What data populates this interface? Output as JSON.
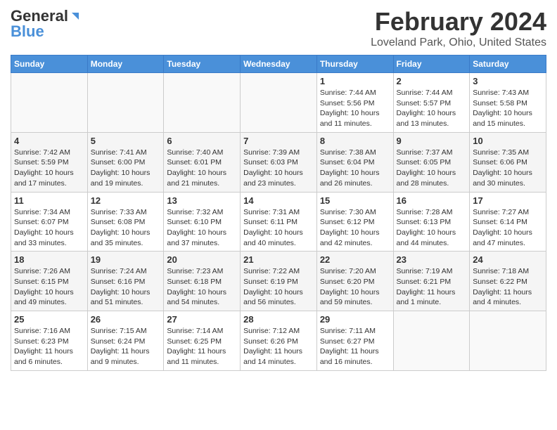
{
  "header": {
    "logo_general": "General",
    "logo_blue": "Blue",
    "month_title": "February 2024",
    "location": "Loveland Park, Ohio, United States"
  },
  "calendar": {
    "days_of_week": [
      "Sunday",
      "Monday",
      "Tuesday",
      "Wednesday",
      "Thursday",
      "Friday",
      "Saturday"
    ],
    "weeks": [
      [
        {
          "day": "",
          "info": ""
        },
        {
          "day": "",
          "info": ""
        },
        {
          "day": "",
          "info": ""
        },
        {
          "day": "",
          "info": ""
        },
        {
          "day": "1",
          "info": "Sunrise: 7:44 AM\nSunset: 5:56 PM\nDaylight: 10 hours\nand 11 minutes."
        },
        {
          "day": "2",
          "info": "Sunrise: 7:44 AM\nSunset: 5:57 PM\nDaylight: 10 hours\nand 13 minutes."
        },
        {
          "day": "3",
          "info": "Sunrise: 7:43 AM\nSunset: 5:58 PM\nDaylight: 10 hours\nand 15 minutes."
        }
      ],
      [
        {
          "day": "4",
          "info": "Sunrise: 7:42 AM\nSunset: 5:59 PM\nDaylight: 10 hours\nand 17 minutes."
        },
        {
          "day": "5",
          "info": "Sunrise: 7:41 AM\nSunset: 6:00 PM\nDaylight: 10 hours\nand 19 minutes."
        },
        {
          "day": "6",
          "info": "Sunrise: 7:40 AM\nSunset: 6:01 PM\nDaylight: 10 hours\nand 21 minutes."
        },
        {
          "day": "7",
          "info": "Sunrise: 7:39 AM\nSunset: 6:03 PM\nDaylight: 10 hours\nand 23 minutes."
        },
        {
          "day": "8",
          "info": "Sunrise: 7:38 AM\nSunset: 6:04 PM\nDaylight: 10 hours\nand 26 minutes."
        },
        {
          "day": "9",
          "info": "Sunrise: 7:37 AM\nSunset: 6:05 PM\nDaylight: 10 hours\nand 28 minutes."
        },
        {
          "day": "10",
          "info": "Sunrise: 7:35 AM\nSunset: 6:06 PM\nDaylight: 10 hours\nand 30 minutes."
        }
      ],
      [
        {
          "day": "11",
          "info": "Sunrise: 7:34 AM\nSunset: 6:07 PM\nDaylight: 10 hours\nand 33 minutes."
        },
        {
          "day": "12",
          "info": "Sunrise: 7:33 AM\nSunset: 6:08 PM\nDaylight: 10 hours\nand 35 minutes."
        },
        {
          "day": "13",
          "info": "Sunrise: 7:32 AM\nSunset: 6:10 PM\nDaylight: 10 hours\nand 37 minutes."
        },
        {
          "day": "14",
          "info": "Sunrise: 7:31 AM\nSunset: 6:11 PM\nDaylight: 10 hours\nand 40 minutes."
        },
        {
          "day": "15",
          "info": "Sunrise: 7:30 AM\nSunset: 6:12 PM\nDaylight: 10 hours\nand 42 minutes."
        },
        {
          "day": "16",
          "info": "Sunrise: 7:28 AM\nSunset: 6:13 PM\nDaylight: 10 hours\nand 44 minutes."
        },
        {
          "day": "17",
          "info": "Sunrise: 7:27 AM\nSunset: 6:14 PM\nDaylight: 10 hours\nand 47 minutes."
        }
      ],
      [
        {
          "day": "18",
          "info": "Sunrise: 7:26 AM\nSunset: 6:15 PM\nDaylight: 10 hours\nand 49 minutes."
        },
        {
          "day": "19",
          "info": "Sunrise: 7:24 AM\nSunset: 6:16 PM\nDaylight: 10 hours\nand 51 minutes."
        },
        {
          "day": "20",
          "info": "Sunrise: 7:23 AM\nSunset: 6:18 PM\nDaylight: 10 hours\nand 54 minutes."
        },
        {
          "day": "21",
          "info": "Sunrise: 7:22 AM\nSunset: 6:19 PM\nDaylight: 10 hours\nand 56 minutes."
        },
        {
          "day": "22",
          "info": "Sunrise: 7:20 AM\nSunset: 6:20 PM\nDaylight: 10 hours\nand 59 minutes."
        },
        {
          "day": "23",
          "info": "Sunrise: 7:19 AM\nSunset: 6:21 PM\nDaylight: 11 hours\nand 1 minute."
        },
        {
          "day": "24",
          "info": "Sunrise: 7:18 AM\nSunset: 6:22 PM\nDaylight: 11 hours\nand 4 minutes."
        }
      ],
      [
        {
          "day": "25",
          "info": "Sunrise: 7:16 AM\nSunset: 6:23 PM\nDaylight: 11 hours\nand 6 minutes."
        },
        {
          "day": "26",
          "info": "Sunrise: 7:15 AM\nSunset: 6:24 PM\nDaylight: 11 hours\nand 9 minutes."
        },
        {
          "day": "27",
          "info": "Sunrise: 7:14 AM\nSunset: 6:25 PM\nDaylight: 11 hours\nand 11 minutes."
        },
        {
          "day": "28",
          "info": "Sunrise: 7:12 AM\nSunset: 6:26 PM\nDaylight: 11 hours\nand 14 minutes."
        },
        {
          "day": "29",
          "info": "Sunrise: 7:11 AM\nSunset: 6:27 PM\nDaylight: 11 hours\nand 16 minutes."
        },
        {
          "day": "",
          "info": ""
        },
        {
          "day": "",
          "info": ""
        }
      ]
    ]
  }
}
